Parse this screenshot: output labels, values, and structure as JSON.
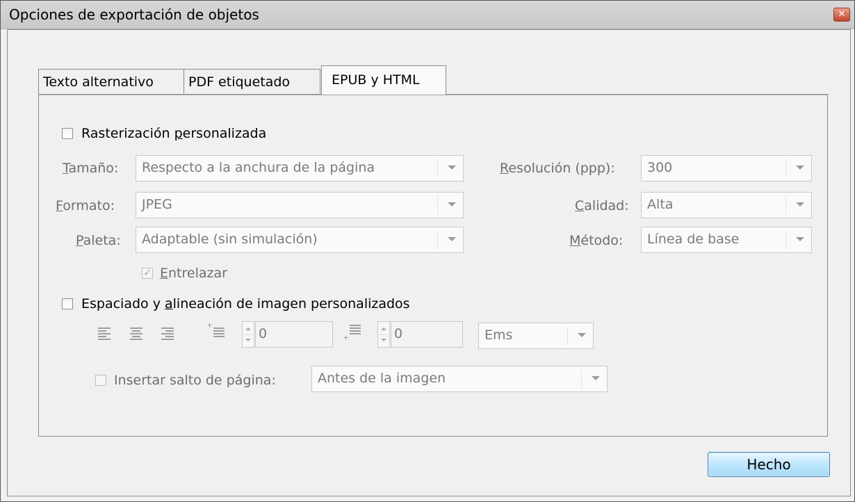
{
  "window": {
    "title": "Opciones de exportación de objetos"
  },
  "tabs": [
    {
      "label": "Texto alternativo",
      "active": false
    },
    {
      "label": "PDF etiquetado",
      "active": false
    },
    {
      "label": "EPUB y HTML",
      "active": true
    }
  ],
  "raster": {
    "checkbox_label_pre": "Rasterización ",
    "checkbox_label_ul": "p",
    "checkbox_label_post": "ersonalizada",
    "checked": false,
    "size": {
      "label_ul": "T",
      "label_rest": "amaño:",
      "value": "Respecto a la anchura de la página"
    },
    "format": {
      "label_ul": "F",
      "label_rest": "ormato:",
      "value": "JPEG"
    },
    "palette": {
      "label_ul": "P",
      "label_rest": "aleta:",
      "value": "Adaptable (sin simulación)"
    },
    "resolution": {
      "label_ul": "R",
      "label_rest": "esolución (ppp):",
      "value": "300"
    },
    "quality": {
      "label_ul": "C",
      "label_rest": "alidad:",
      "value": "Alta"
    },
    "method": {
      "label_ul": "M",
      "label_rest": "étodo:",
      "value": "Línea de base"
    },
    "interlace": {
      "label_ul": "E",
      "label_rest": "ntrelazar",
      "checked": true
    }
  },
  "spacing": {
    "checkbox_label_pre": "Espaciado y ",
    "checkbox_label_ul": "a",
    "checkbox_label_post": "lineación de imagen personalizados",
    "checked": false,
    "space_before": "0",
    "space_after": "0",
    "units": "Ems",
    "page_break": {
      "label": "Insertar salto de página:",
      "checked": false,
      "value": "Antes de la imagen"
    }
  },
  "buttons": {
    "done": "Hecho"
  }
}
